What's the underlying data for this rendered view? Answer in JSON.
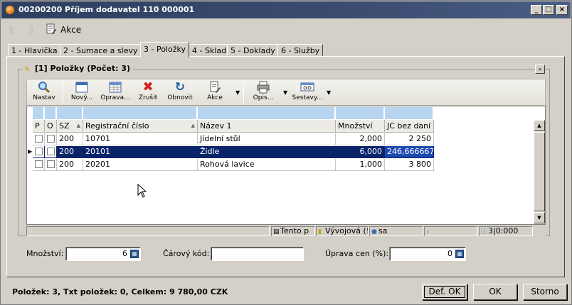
{
  "window": {
    "title": "00200200  Příjem dodavatel  110 000001",
    "controls": [
      "_",
      "□",
      "×"
    ]
  },
  "actionbar": {
    "akce_label": "Akce"
  },
  "tabs": [
    {
      "label": "1 - Hlavička"
    },
    {
      "label": "2 - Sumace a slevy"
    },
    {
      "label": "3 - Položky"
    },
    {
      "label": "4 - Sklad"
    },
    {
      "label": "5 - Doklady"
    },
    {
      "label": "6 - Služby"
    }
  ],
  "group": {
    "title": "[1] Položky  (Počet: 3)",
    "collapse": "»"
  },
  "toolbar": {
    "nastav": "Nastav",
    "novy": "Nový...",
    "oprava": "Oprava...",
    "zrusit": "Zrušit",
    "obnovit": "Obnovit",
    "akce": "Akce",
    "opis": "Opis...",
    "sestavy": "Sestavy..."
  },
  "grid": {
    "columns": [
      {
        "label": "P"
      },
      {
        "label": "O"
      },
      {
        "label": "SZ"
      },
      {
        "label": "Registrační číslo"
      },
      {
        "label": "Název 1"
      },
      {
        "label": "Množství"
      },
      {
        "label": "JC bez daní"
      }
    ],
    "rows": [
      {
        "sz": "200",
        "reg": "10701",
        "nazev": "Jídelní stůl",
        "mnozstvi": "2,000",
        "jc": "2 250"
      },
      {
        "sz": "200",
        "reg": "20101",
        "nazev": "Židle",
        "mnozstvi": "6,000",
        "jc": "246,666667"
      },
      {
        "sz": "200",
        "reg": "20201",
        "nazev": "Rohová lavice",
        "mnozstvi": "1,000",
        "jc": "3 800"
      }
    ],
    "selected_row": 1
  },
  "statusbar": {
    "tento": "Tento p",
    "vyvojova": "Vývojová (!",
    "user": "sa",
    "counter": "3|0:000"
  },
  "fields": {
    "mnozstvi_label": "Množství:",
    "mnozstvi_value": "6",
    "carovy_label": "Čárový kód:",
    "carovy_value": "",
    "uprava_label": "Úprava cen (%):",
    "uprava_value": "0"
  },
  "footer": {
    "summary": "Položek: 3,  Txt položek: 0,  Celkem: 9 780,00 CZK",
    "def_ok": "Def. OK",
    "ok": "OK",
    "storno": "Storno"
  }
}
